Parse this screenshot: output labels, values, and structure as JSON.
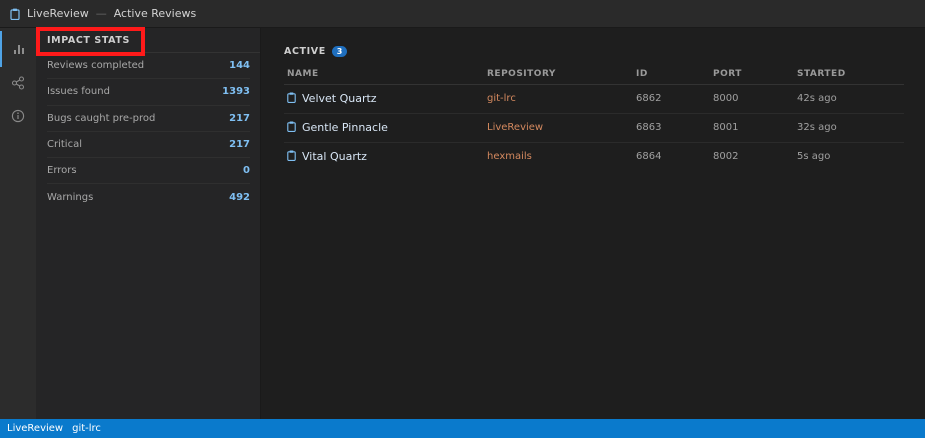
{
  "titlebar": {
    "app": "LiveReview",
    "separator": "—",
    "page": "Active Reviews"
  },
  "activitybar": {
    "items": [
      {
        "icon": "bar-chart-icon",
        "active": true
      },
      {
        "icon": "share-icon",
        "active": false
      },
      {
        "icon": "info-icon",
        "active": false
      }
    ]
  },
  "sidebar": {
    "title": "IMPACT STATS",
    "stats": [
      {
        "label": "Reviews completed",
        "value": "144"
      },
      {
        "label": "Issues found",
        "value": "1393"
      },
      {
        "label": "Bugs caught pre-prod",
        "value": "217"
      },
      {
        "label": "Critical",
        "value": "217"
      },
      {
        "label": "Errors",
        "value": "0"
      },
      {
        "label": "Warnings",
        "value": "492"
      }
    ]
  },
  "main": {
    "section_label": "ACTIVE",
    "count": "3",
    "columns": [
      "NAME",
      "REPOSITORY",
      "ID",
      "PORT",
      "STARTED"
    ],
    "rows": [
      {
        "name": "Velvet Quartz",
        "repo": "git-lrc",
        "id": "6862",
        "port": "8000",
        "started": "42s ago"
      },
      {
        "name": "Gentle Pinnacle",
        "repo": "LiveReview",
        "id": "6863",
        "port": "8001",
        "started": "32s ago"
      },
      {
        "name": "Vital Quartz",
        "repo": "hexmails",
        "id": "6864",
        "port": "8002",
        "started": "5s ago"
      }
    ]
  },
  "statusbar": {
    "items": [
      "LiveReview",
      "git-lrc"
    ]
  },
  "colors": {
    "accent": "#0a7acc",
    "stat_value": "#7fbff2",
    "repo": "#d4895f",
    "highlight": "#ff1a1a"
  }
}
